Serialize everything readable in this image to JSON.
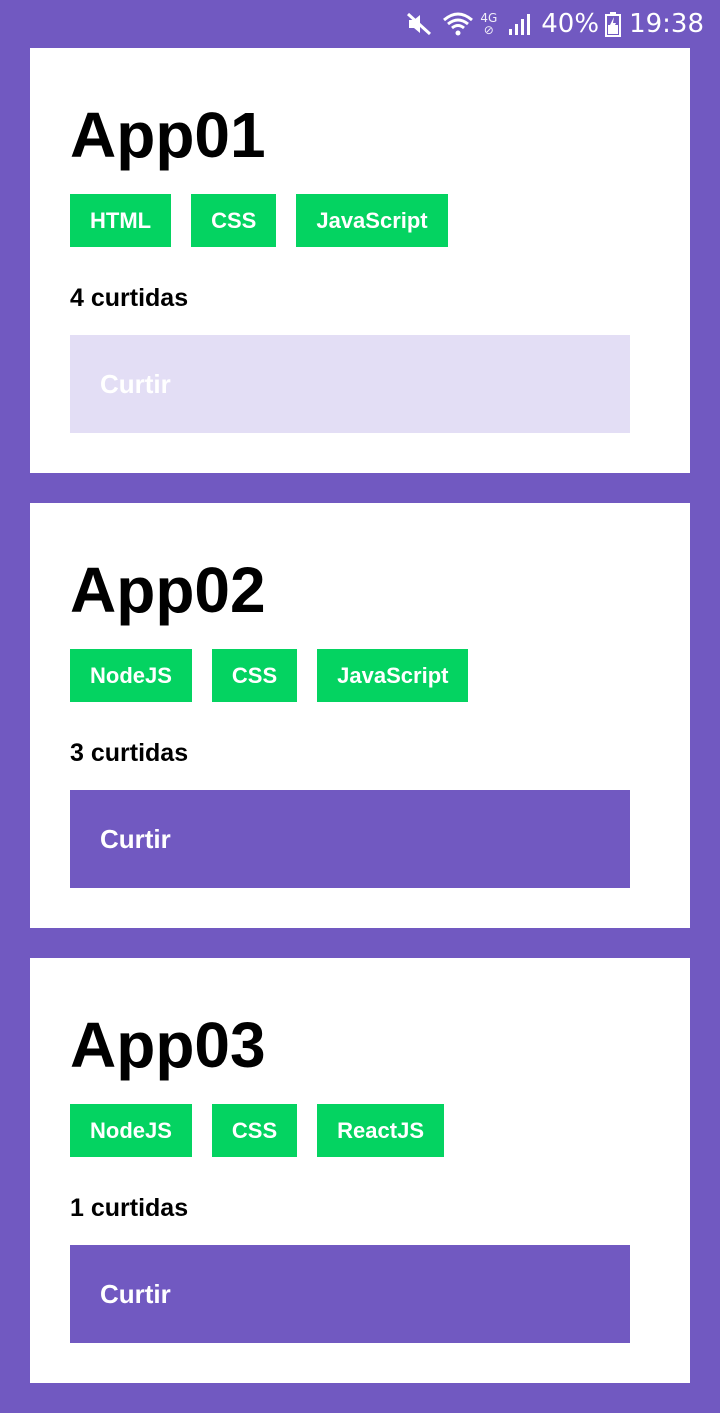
{
  "status_bar": {
    "battery": "40%",
    "time": "19:38",
    "network_type": "4G",
    "icons": [
      "mute-icon",
      "wifi-icon",
      "signal-icon",
      "battery-icon"
    ]
  },
  "colors": {
    "background": "#7159c1",
    "card": "#ffffff",
    "tag": "#04d361",
    "button": "#7159c1",
    "button_disabled": "#e3def5"
  },
  "cards": [
    {
      "title": "App01",
      "tags": [
        "HTML",
        "CSS",
        "JavaScript"
      ],
      "likes": "4 curtidas",
      "button": "Curtir",
      "button_disabled": true
    },
    {
      "title": "App02",
      "tags": [
        "NodeJS",
        "CSS",
        "JavaScript"
      ],
      "likes": "3 curtidas",
      "button": "Curtir",
      "button_disabled": false
    },
    {
      "title": "App03",
      "tags": [
        "NodeJS",
        "CSS",
        "ReactJS"
      ],
      "likes": "1 curtidas",
      "button": "Curtir",
      "button_disabled": false
    }
  ]
}
